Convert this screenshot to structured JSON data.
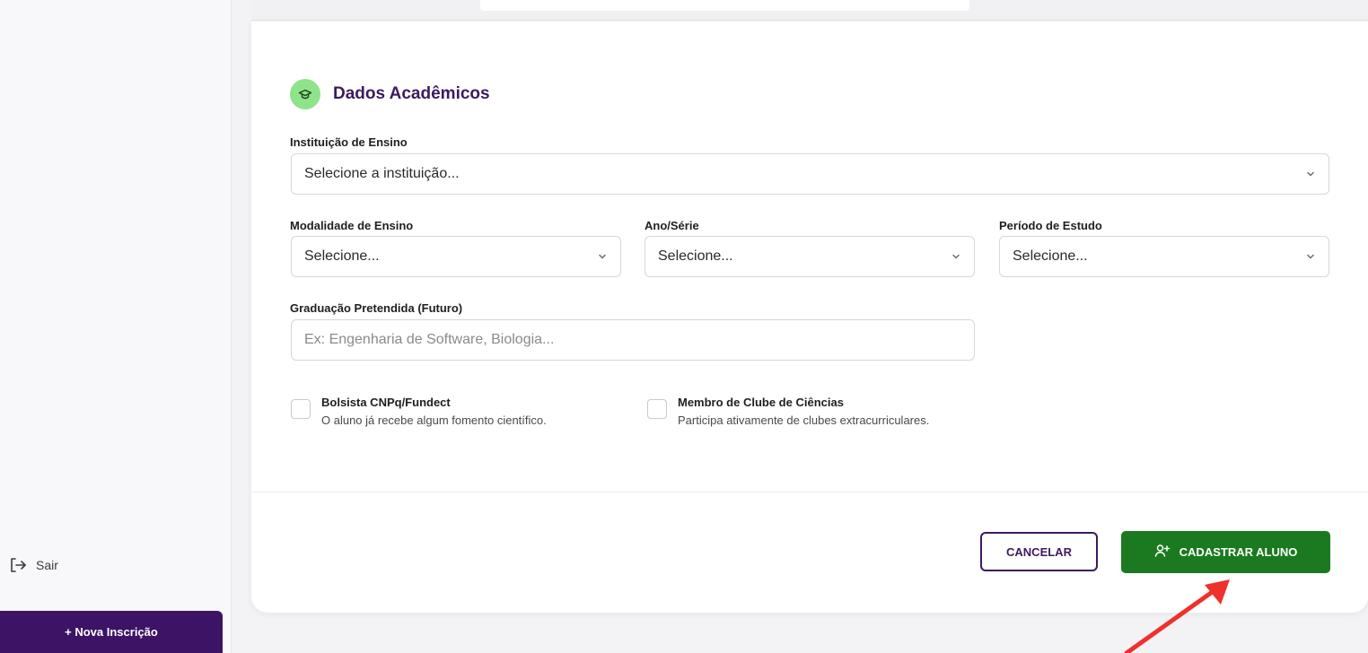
{
  "sidebar": {
    "logout_label": "Sair",
    "new_enrollment_label": "+ Nova Inscrição"
  },
  "section": {
    "title": "Dados Acadêmicos",
    "icon": "graduation-cap-icon"
  },
  "fields": {
    "institution": {
      "label": "Instituição de Ensino",
      "value": "Selecione a instituição..."
    },
    "modality": {
      "label": "Modalidade de Ensino",
      "value": "Selecione..."
    },
    "year": {
      "label": "Ano/Série",
      "value": "Selecione..."
    },
    "period": {
      "label": "Período de Estudo",
      "value": "Selecione..."
    },
    "graduation": {
      "label": "Graduação Pretendida (Futuro)",
      "placeholder": "Ex: Engenharia de Software, Biologia..."
    }
  },
  "checkboxes": [
    {
      "title": "Bolsista CNPq/Fundect",
      "description": "O aluno já recebe algum fomento científico.",
      "checked": false
    },
    {
      "title": "Membro de Clube de Ciências",
      "description": "Participa ativamente de clubes extracurriculares.",
      "checked": false
    }
  ],
  "actions": {
    "cancel_label": "CANCELAR",
    "submit_label": "CADASTRAR ALUNO"
  },
  "colors": {
    "primary_purple": "#3d1366",
    "submit_green": "#1b7a1f",
    "section_icon_bg": "#8fe38a",
    "annotation_arrow": "#f0302c"
  }
}
